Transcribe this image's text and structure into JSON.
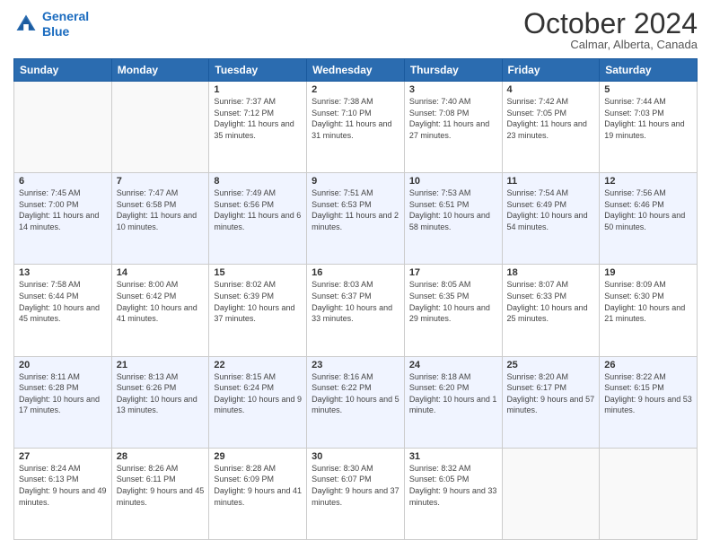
{
  "header": {
    "logo_line1": "General",
    "logo_line2": "Blue",
    "month": "October 2024",
    "location": "Calmar, Alberta, Canada"
  },
  "weekdays": [
    "Sunday",
    "Monday",
    "Tuesday",
    "Wednesday",
    "Thursday",
    "Friday",
    "Saturday"
  ],
  "weeks": [
    [
      {
        "day": "",
        "info": ""
      },
      {
        "day": "",
        "info": ""
      },
      {
        "day": "1",
        "info": "Sunrise: 7:37 AM\nSunset: 7:12 PM\nDaylight: 11 hours and 35 minutes."
      },
      {
        "day": "2",
        "info": "Sunrise: 7:38 AM\nSunset: 7:10 PM\nDaylight: 11 hours and 31 minutes."
      },
      {
        "day": "3",
        "info": "Sunrise: 7:40 AM\nSunset: 7:08 PM\nDaylight: 11 hours and 27 minutes."
      },
      {
        "day": "4",
        "info": "Sunrise: 7:42 AM\nSunset: 7:05 PM\nDaylight: 11 hours and 23 minutes."
      },
      {
        "day": "5",
        "info": "Sunrise: 7:44 AM\nSunset: 7:03 PM\nDaylight: 11 hours and 19 minutes."
      }
    ],
    [
      {
        "day": "6",
        "info": "Sunrise: 7:45 AM\nSunset: 7:00 PM\nDaylight: 11 hours and 14 minutes."
      },
      {
        "day": "7",
        "info": "Sunrise: 7:47 AM\nSunset: 6:58 PM\nDaylight: 11 hours and 10 minutes."
      },
      {
        "day": "8",
        "info": "Sunrise: 7:49 AM\nSunset: 6:56 PM\nDaylight: 11 hours and 6 minutes."
      },
      {
        "day": "9",
        "info": "Sunrise: 7:51 AM\nSunset: 6:53 PM\nDaylight: 11 hours and 2 minutes."
      },
      {
        "day": "10",
        "info": "Sunrise: 7:53 AM\nSunset: 6:51 PM\nDaylight: 10 hours and 58 minutes."
      },
      {
        "day": "11",
        "info": "Sunrise: 7:54 AM\nSunset: 6:49 PM\nDaylight: 10 hours and 54 minutes."
      },
      {
        "day": "12",
        "info": "Sunrise: 7:56 AM\nSunset: 6:46 PM\nDaylight: 10 hours and 50 minutes."
      }
    ],
    [
      {
        "day": "13",
        "info": "Sunrise: 7:58 AM\nSunset: 6:44 PM\nDaylight: 10 hours and 45 minutes."
      },
      {
        "day": "14",
        "info": "Sunrise: 8:00 AM\nSunset: 6:42 PM\nDaylight: 10 hours and 41 minutes."
      },
      {
        "day": "15",
        "info": "Sunrise: 8:02 AM\nSunset: 6:39 PM\nDaylight: 10 hours and 37 minutes."
      },
      {
        "day": "16",
        "info": "Sunrise: 8:03 AM\nSunset: 6:37 PM\nDaylight: 10 hours and 33 minutes."
      },
      {
        "day": "17",
        "info": "Sunrise: 8:05 AM\nSunset: 6:35 PM\nDaylight: 10 hours and 29 minutes."
      },
      {
        "day": "18",
        "info": "Sunrise: 8:07 AM\nSunset: 6:33 PM\nDaylight: 10 hours and 25 minutes."
      },
      {
        "day": "19",
        "info": "Sunrise: 8:09 AM\nSunset: 6:30 PM\nDaylight: 10 hours and 21 minutes."
      }
    ],
    [
      {
        "day": "20",
        "info": "Sunrise: 8:11 AM\nSunset: 6:28 PM\nDaylight: 10 hours and 17 minutes."
      },
      {
        "day": "21",
        "info": "Sunrise: 8:13 AM\nSunset: 6:26 PM\nDaylight: 10 hours and 13 minutes."
      },
      {
        "day": "22",
        "info": "Sunrise: 8:15 AM\nSunset: 6:24 PM\nDaylight: 10 hours and 9 minutes."
      },
      {
        "day": "23",
        "info": "Sunrise: 8:16 AM\nSunset: 6:22 PM\nDaylight: 10 hours and 5 minutes."
      },
      {
        "day": "24",
        "info": "Sunrise: 8:18 AM\nSunset: 6:20 PM\nDaylight: 10 hours and 1 minute."
      },
      {
        "day": "25",
        "info": "Sunrise: 8:20 AM\nSunset: 6:17 PM\nDaylight: 9 hours and 57 minutes."
      },
      {
        "day": "26",
        "info": "Sunrise: 8:22 AM\nSunset: 6:15 PM\nDaylight: 9 hours and 53 minutes."
      }
    ],
    [
      {
        "day": "27",
        "info": "Sunrise: 8:24 AM\nSunset: 6:13 PM\nDaylight: 9 hours and 49 minutes."
      },
      {
        "day": "28",
        "info": "Sunrise: 8:26 AM\nSunset: 6:11 PM\nDaylight: 9 hours and 45 minutes."
      },
      {
        "day": "29",
        "info": "Sunrise: 8:28 AM\nSunset: 6:09 PM\nDaylight: 9 hours and 41 minutes."
      },
      {
        "day": "30",
        "info": "Sunrise: 8:30 AM\nSunset: 6:07 PM\nDaylight: 9 hours and 37 minutes."
      },
      {
        "day": "31",
        "info": "Sunrise: 8:32 AM\nSunset: 6:05 PM\nDaylight: 9 hours and 33 minutes."
      },
      {
        "day": "",
        "info": ""
      },
      {
        "day": "",
        "info": ""
      }
    ]
  ]
}
